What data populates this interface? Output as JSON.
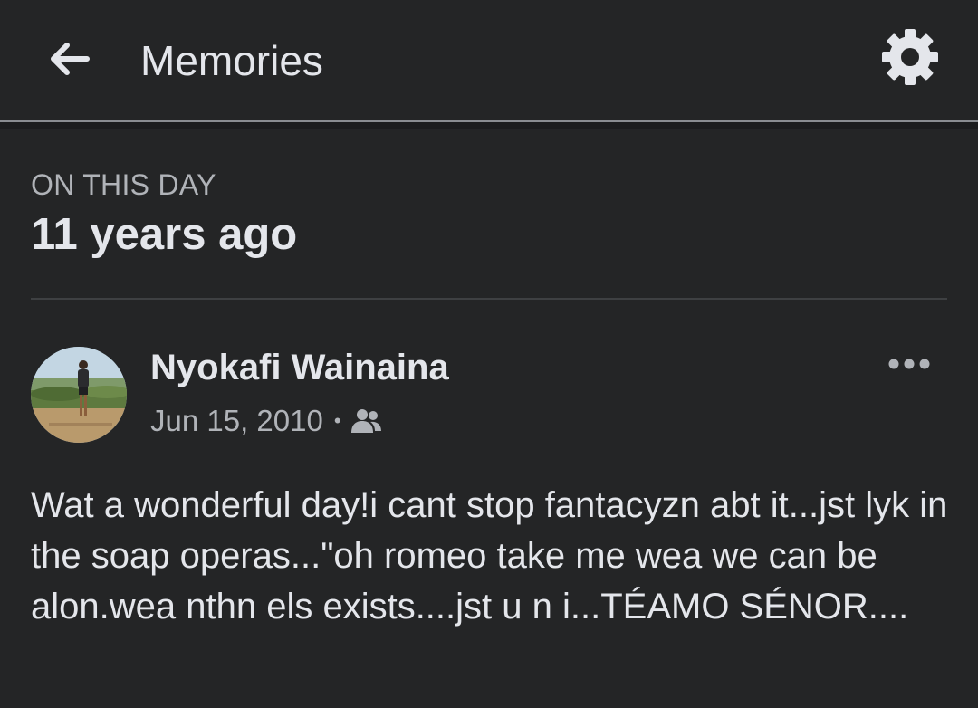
{
  "header": {
    "title": "Memories",
    "back_icon": "arrow-left-icon",
    "settings_icon": "gear-icon"
  },
  "section": {
    "kicker": "ON THIS DAY",
    "title": "11 years ago"
  },
  "post": {
    "author": "Nyokafi Wainaina",
    "date": "Jun 15, 2010",
    "separator": "•",
    "audience_icon": "friends-icon",
    "more_icon": "more-horizontal-icon",
    "text": "Wat a wonderful day!i cant stop fantacyzn abt it...jst lyk in the soap operas...\"oh romeo take me wea we can be alon.wea nthn els exists....jst u n i...TÉAMO SÉNOR...."
  },
  "colors": {
    "background": "#242526",
    "primary_text": "#e4e6eb",
    "secondary_text": "#b0b3b8",
    "divider": "#3e4042"
  }
}
